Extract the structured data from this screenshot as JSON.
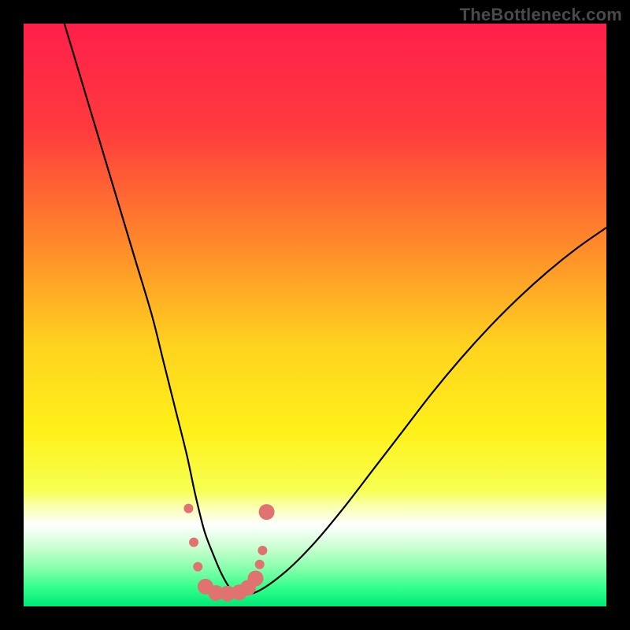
{
  "watermark": "TheBottleneck.com",
  "chart_data": {
    "type": "line",
    "title": "",
    "xlabel": "",
    "ylabel": "",
    "xlim": [
      0,
      100
    ],
    "ylim": [
      0,
      100
    ],
    "background_gradient": {
      "stops": [
        {
          "offset": 0,
          "color": "#ff1f4b"
        },
        {
          "offset": 18,
          "color": "#ff3a3e"
        },
        {
          "offset": 38,
          "color": "#ff8a2a"
        },
        {
          "offset": 55,
          "color": "#ffd21f"
        },
        {
          "offset": 70,
          "color": "#fff11a"
        },
        {
          "offset": 80,
          "color": "#f7ff50"
        },
        {
          "offset": 83,
          "color": "#f9ffb2"
        },
        {
          "offset": 86,
          "color": "#ffffff"
        },
        {
          "offset": 90,
          "color": "#c9ffd0"
        },
        {
          "offset": 94,
          "color": "#7affa6"
        },
        {
          "offset": 97,
          "color": "#2dff89"
        },
        {
          "offset": 100,
          "color": "#00e876"
        }
      ]
    },
    "series": [
      {
        "name": "bottleneck-curve",
        "type": "line",
        "stroke": "#000000",
        "stroke_width": 2.2,
        "x": [
          7,
          10,
          13,
          16,
          19,
          22,
          24,
          26,
          28,
          29.5,
          31,
          32.5,
          34,
          35.5,
          36.7,
          40,
          45,
          50,
          55,
          60,
          65,
          70,
          75,
          80,
          85,
          90,
          95,
          100
        ],
        "y": [
          100,
          90,
          80,
          70,
          60,
          50,
          42,
          34,
          26,
          19,
          13,
          9,
          5.5,
          3,
          2.2,
          2.5,
          6,
          11,
          17,
          23.5,
          30,
          36.5,
          42.5,
          48,
          53,
          57.5,
          61.5,
          65
        ]
      },
      {
        "name": "trough-markers",
        "type": "scatter",
        "stroke": "#e0736f",
        "fill": "#e0736f",
        "marker_radius_small": 6,
        "marker_radius_large": 10,
        "points": [
          {
            "x": 28.3,
            "y": 16.8,
            "r": "small"
          },
          {
            "x": 29.2,
            "y": 11.0,
            "r": "small"
          },
          {
            "x": 29.9,
            "y": 6.8,
            "r": "small"
          },
          {
            "x": 31.2,
            "y": 3.4,
            "r": "large"
          },
          {
            "x": 33.0,
            "y": 2.3,
            "r": "large"
          },
          {
            "x": 35.0,
            "y": 2.2,
            "r": "large"
          },
          {
            "x": 37.0,
            "y": 2.4,
            "r": "large"
          },
          {
            "x": 38.5,
            "y": 3.2,
            "r": "large"
          },
          {
            "x": 39.8,
            "y": 4.8,
            "r": "large"
          },
          {
            "x": 40.5,
            "y": 7.2,
            "r": "small"
          },
          {
            "x": 41.0,
            "y": 9.6,
            "r": "small"
          },
          {
            "x": 41.7,
            "y": 16.2,
            "r": "large"
          }
        ]
      }
    ]
  }
}
